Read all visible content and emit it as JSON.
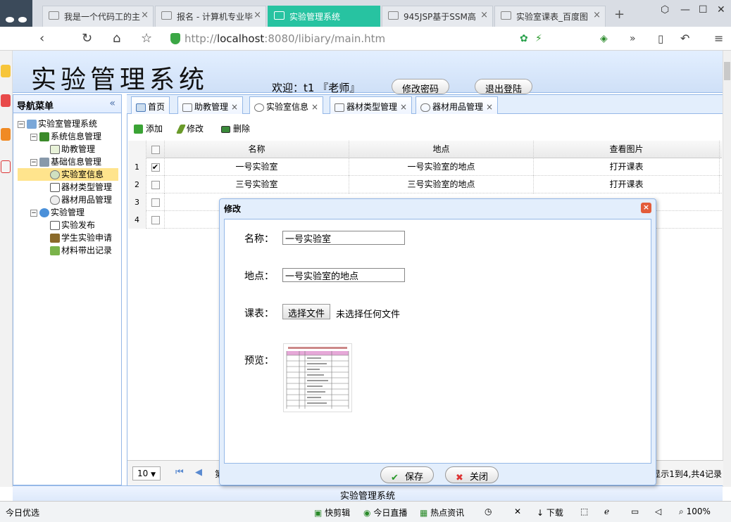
{
  "browser": {
    "tabs": [
      {
        "label": "我是一个代码工的主"
      },
      {
        "label": "报名 - 计算机专业毕"
      },
      {
        "label": "实验管理系统"
      },
      {
        "label": "945JSP基于SSM高"
      },
      {
        "label": "实验室课表_百度图"
      }
    ],
    "url_scheme": "http://",
    "url_host": "localhost",
    "url_rest": ":8080/libiary/main.htm",
    "new_tab": "+"
  },
  "header": {
    "title": "实验管理系统",
    "welcome": "欢迎：t1 『老师』",
    "change_password": "修改密码",
    "logout": "退出登陆"
  },
  "nav": {
    "title": "导航菜单",
    "collapse": "«",
    "items": [
      {
        "label": "实验室管理系统"
      },
      {
        "label": "系统信息管理"
      },
      {
        "label": "助教管理"
      },
      {
        "label": "基础信息管理"
      },
      {
        "label": "实验室信息"
      },
      {
        "label": "器材类型管理"
      },
      {
        "label": "器材用品管理"
      },
      {
        "label": "实验管理"
      },
      {
        "label": "实验发布"
      },
      {
        "label": "学生实验申请"
      },
      {
        "label": "材料带出记录"
      }
    ]
  },
  "tabs": [
    {
      "label": "首页"
    },
    {
      "label": "助教管理"
    },
    {
      "label": "实验室信息"
    },
    {
      "label": "器材类型管理"
    },
    {
      "label": "器材用品管理"
    }
  ],
  "toolbar": {
    "add": "添加",
    "edit": "修改",
    "delete": "删除"
  },
  "grid": {
    "columns": [
      "名称",
      "地点",
      "查看图片"
    ],
    "rows": [
      {
        "num": "1",
        "name": "一号实验室",
        "location": "一号实验室的地点",
        "link": "打开课表"
      },
      {
        "num": "2",
        "name": "三号实验室",
        "location": "三号实验室的地点",
        "link": "打开课表"
      },
      {
        "num": "3"
      },
      {
        "num": "4"
      }
    ]
  },
  "pager": {
    "size": "10",
    "page_prefix": "第",
    "info": "显示1到4,共4记录"
  },
  "dialog": {
    "title": "修改",
    "name_label": "名称：",
    "name_value": "一号实验室",
    "location_label": "地点：",
    "location_value": "一号实验室的地点",
    "schedule_label": "课表：",
    "file_button": "选择文件",
    "file_status": "未选择任何文件",
    "preview_label": "预览：",
    "save": "保存",
    "close": "关闭"
  },
  "footer": {
    "text": "实验管理系统"
  },
  "statusbar": {
    "left": "今日优选",
    "items": [
      "快剪辑",
      "今日直播",
      "热点资讯",
      "下载"
    ],
    "zoom": "100%"
  },
  "colors": {
    "accent": "#27c3a1",
    "panel_border": "#95b8e7",
    "selected": "#ffe48d"
  }
}
